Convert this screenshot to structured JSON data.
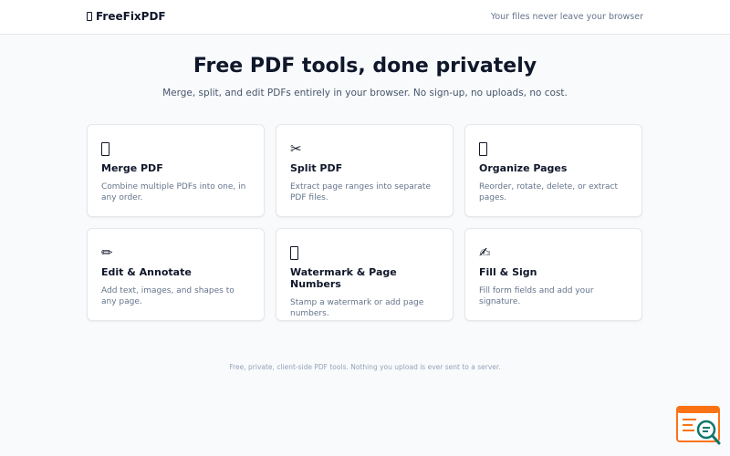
{
  "header": {
    "brand": "FreeFixPDF",
    "tagline": "Your files never leave your browser"
  },
  "hero": {
    "title": "Free PDF tools, done privately",
    "subtitle": "Merge, split, and edit PDFs entirely in your browser. No sign-up, no uploads, no cost."
  },
  "tools": [
    {
      "icon": "document-icon",
      "glyph": "",
      "title": "Merge PDF",
      "description": "Combine multiple PDFs into one, in any order."
    },
    {
      "icon": "scissors-icon",
      "glyph": "✂",
      "title": "Split PDF",
      "description": "Extract page ranges into separate PDF files."
    },
    {
      "icon": "pages-icon",
      "glyph": "",
      "title": "Organize Pages",
      "description": "Reorder, rotate, delete, or extract pages."
    },
    {
      "icon": "pencil-icon",
      "glyph": "✏",
      "title": "Edit & Annotate",
      "description": "Add text, images, and shapes to any page."
    },
    {
      "icon": "watermark-icon",
      "glyph": "",
      "title": "Watermark & Page Numbers",
      "description": "Stamp a watermark or add page numbers."
    },
    {
      "icon": "signature-icon",
      "glyph": "✍",
      "title": "Fill & Sign",
      "description": "Fill form fields and add your signature."
    }
  ],
  "footer": {
    "text": "Free, private, client-side PDF tools. Nothing you upload is ever sent to a server."
  },
  "colors": {
    "background": "#f8fafc",
    "card": "#ffffff",
    "border": "#e5e7eb",
    "heading": "#0f172a",
    "muted": "#64748b",
    "widget_accent": "#f97316",
    "widget_lens": "#0f766e"
  }
}
